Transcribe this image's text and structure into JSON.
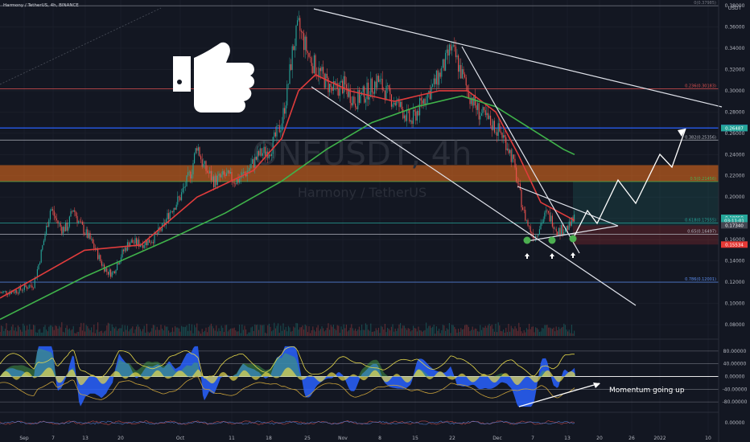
{
  "header": {
    "title": "Harmony / TetherUS, 4h, BINANCE"
  },
  "watermark": {
    "symbol": "ONEUSDT, 4h",
    "name": "Harmony / TetherUS"
  },
  "annotation": {
    "momentum_text": "Momentum going up"
  },
  "chart_data": [
    {
      "type": "candlestick",
      "title": "Harmony / TetherUS, 4h, BINANCE",
      "currency": "USDT",
      "ylim": [
        0.065,
        0.38
      ],
      "y_ticks": [
        "0.38000",
        "0.36000",
        "0.34000",
        "0.32000",
        "0.30000",
        "0.28000",
        "0.26000",
        "0.24000",
        "0.22000",
        "0.20000",
        "0.18000",
        "0.16000",
        "0.14000",
        "0.12000",
        "0.10000",
        "0.08000"
      ],
      "x_ticks": [
        "Sep",
        "7",
        "13",
        "20",
        "Oct",
        "11",
        "18",
        "25",
        "Nov",
        "8",
        "15",
        "22",
        "Dec",
        "7",
        "13",
        "20",
        "26",
        "2022",
        "10"
      ],
      "close_path": [
        [
          0,
          0.11
        ],
        [
          3,
          0.112
        ],
        [
          6,
          0.118
        ],
        [
          7,
          0.14
        ],
        [
          8,
          0.165
        ],
        [
          9,
          0.19
        ],
        [
          10,
          0.178
        ],
        [
          11,
          0.17
        ],
        [
          12,
          0.172
        ],
        [
          13,
          0.19
        ],
        [
          14,
          0.176
        ],
        [
          15,
          0.168
        ],
        [
          16,
          0.16
        ],
        [
          17,
          0.15
        ],
        [
          18,
          0.138
        ],
        [
          19,
          0.13
        ],
        [
          20,
          0.128
        ],
        [
          21,
          0.14
        ],
        [
          22,
          0.15
        ],
        [
          23,
          0.158
        ],
        [
          25,
          0.156
        ],
        [
          27,
          0.16
        ],
        [
          29,
          0.172
        ],
        [
          30,
          0.185
        ],
        [
          32,
          0.2
        ],
        [
          34,
          0.225
        ],
        [
          35,
          0.25
        ],
        [
          36,
          0.23
        ],
        [
          38,
          0.215
        ],
        [
          40,
          0.22
        ],
        [
          42,
          0.215
        ],
        [
          44,
          0.225
        ],
        [
          46,
          0.24
        ],
        [
          48,
          0.245
        ],
        [
          50,
          0.27
        ],
        [
          51,
          0.3
        ],
        [
          52,
          0.34
        ],
        [
          53,
          0.36
        ],
        [
          54,
          0.345
        ],
        [
          55,
          0.33
        ],
        [
          57,
          0.315
        ],
        [
          59,
          0.3
        ],
        [
          61,
          0.305
        ],
        [
          63,
          0.29
        ],
        [
          65,
          0.298
        ],
        [
          67,
          0.31
        ],
        [
          69,
          0.295
        ],
        [
          71,
          0.285
        ],
        [
          73,
          0.27
        ],
        [
          75,
          0.29
        ],
        [
          77,
          0.305
        ],
        [
          79,
          0.325
        ],
        [
          80,
          0.34
        ],
        [
          81,
          0.33
        ],
        [
          83,
          0.3
        ],
        [
          85,
          0.28
        ],
        [
          87,
          0.27
        ],
        [
          89,
          0.26
        ],
        [
          90,
          0.25
        ],
        [
          91,
          0.235
        ],
        [
          92,
          0.21
        ],
        [
          93,
          0.185
        ],
        [
          94,
          0.17
        ],
        [
          95,
          0.163
        ],
        [
          96,
          0.175
        ],
        [
          97,
          0.185
        ],
        [
          98,
          0.178
        ],
        [
          99,
          0.168
        ],
        [
          100,
          0.17
        ],
        [
          101,
          0.172
        ],
        [
          102,
          0.18
        ]
      ],
      "moving_averages": [
        {
          "name": "",
          "color": "#e03c3c",
          "points": [
            [
              0,
              0.105
            ],
            [
              15,
              0.15
            ],
            [
              25,
              0.155
            ],
            [
              35,
              0.2
            ],
            [
              45,
              0.225
            ],
            [
              50,
              0.255
            ],
            [
              53,
              0.3
            ],
            [
              56,
              0.315
            ],
            [
              62,
              0.3
            ],
            [
              70,
              0.29
            ],
            [
              78,
              0.3
            ],
            [
              83,
              0.3
            ],
            [
              88,
              0.28
            ],
            [
              92,
              0.24
            ],
            [
              96,
              0.195
            ],
            [
              102,
              0.178
            ]
          ]
        },
        {
          "name": "",
          "color": "#3fb24a",
          "points": [
            [
              0,
              0.085
            ],
            [
              15,
              0.125
            ],
            [
              30,
              0.16
            ],
            [
              40,
              0.185
            ],
            [
              50,
              0.215
            ],
            [
              58,
              0.245
            ],
            [
              66,
              0.27
            ],
            [
              74,
              0.285
            ],
            [
              82,
              0.295
            ],
            [
              88,
              0.285
            ],
            [
              94,
              0.265
            ],
            [
              100,
              0.245
            ],
            [
              102,
              0.24
            ]
          ]
        }
      ],
      "fibonacci_levels": [
        {
          "label": "0(0.37985)",
          "value": 0.37985,
          "color": "#787b86"
        },
        {
          "label": "0.236(0.30183)",
          "value": 0.30183,
          "color": "#e05252"
        },
        {
          "label": "0.382(0.25356)",
          "value": 0.25356,
          "color": "#b2b5be"
        },
        {
          "label": "0.5(0.21456)",
          "value": 0.21456,
          "color": "#4caf50"
        },
        {
          "label": "0.618(0.17555)",
          "value": 0.17555,
          "color": "#26a69a"
        },
        {
          "label": "0.65(0.16497)",
          "value": 0.16497,
          "color": "#b2b5be"
        },
        {
          "label": "0.786(0.12001)",
          "value": 0.12001,
          "color": "#5b8def"
        }
      ],
      "support_zone": [
        0.21456,
        0.23
      ],
      "blue_level": 0.26497,
      "price_labels": [
        {
          "text": "0.26497",
          "value": 0.26497,
          "color": "#2962ff"
        },
        {
          "text": "0.26487",
          "value": 0.26487,
          "color": "#26a69a"
        },
        {
          "text": "0.18050",
          "value": 0.1805,
          "color": "#26a69a"
        },
        {
          "text": "03:11:01",
          "value": 0.1778,
          "color": "#26a69a"
        },
        {
          "text": "0.17340",
          "value": 0.1734,
          "color": "#434651"
        },
        {
          "text": "0.15534",
          "value": 0.15534,
          "color": "#e53935"
        }
      ]
    },
    {
      "type": "area",
      "title": "",
      "y_ticks": [
        "80.00000",
        "40.00000",
        "0.00000",
        "-40.00000",
        "-80.00000"
      ],
      "ylim": [
        -110,
        110
      ]
    },
    {
      "type": "line",
      "title": "",
      "y_ticks": [
        "0.00000"
      ]
    }
  ]
}
